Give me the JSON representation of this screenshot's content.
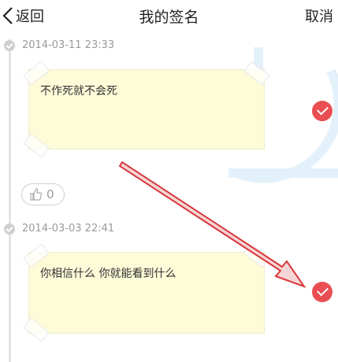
{
  "header": {
    "back_label": "返回",
    "title": "我的签名",
    "cancel_label": "取消"
  },
  "entries": [
    {
      "date": "2014-03-11 23:33",
      "text": "不作死就不会死",
      "selected": true,
      "likes": "0"
    },
    {
      "date": "2014-03-03 22:41",
      "text": "你相信什么 你就能看到什么",
      "selected": true
    }
  ],
  "colors": {
    "check": "#e94f52",
    "note_bg": "#fdfbd8",
    "annotation_arrow": "#d9383c",
    "watermark": "#e3f1fb"
  },
  "icons": {
    "back": "chevron-left-icon",
    "like": "thumbs-up-icon",
    "check": "check-circle-icon",
    "timeline": "timeline-dot-icon"
  }
}
